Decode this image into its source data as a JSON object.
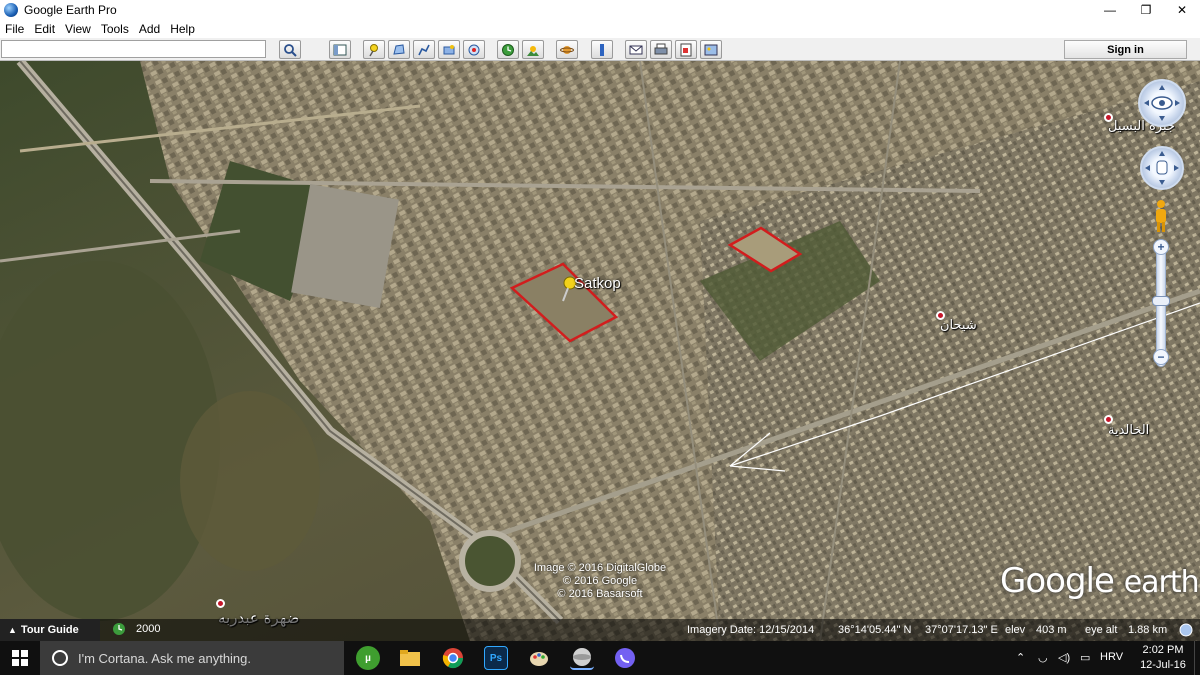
{
  "window": {
    "title": "Google Earth Pro",
    "minimize": "—",
    "maximize": "❐",
    "close": "✕"
  },
  "menu": [
    "File",
    "Edit",
    "View",
    "Tools",
    "Add",
    "Help"
  ],
  "toolbar": {
    "search_value": "",
    "sign_in": "Sign in"
  },
  "map": {
    "placemark_label": "Satkop",
    "places": [
      {
        "name": "ضهرة عبدربه"
      },
      {
        "name": "شيحان"
      },
      {
        "name": "الخالدية"
      },
      {
        "name": "جبرة البسيل"
      }
    ],
    "credits": [
      "Image © 2016 DigitalGlobe",
      "© 2016 Google",
      "© 2016 Basarsoft"
    ],
    "logo": {
      "word1": "Google",
      "word2": "earth"
    }
  },
  "nav": {
    "zoom_in": "+",
    "zoom_out": "−"
  },
  "status": {
    "tour_guide": "Tour Guide",
    "historical_year": "2000",
    "imagery_date": "Imagery Date: 12/15/2014",
    "lat": "36°14'05.44\" N",
    "lon": "37°07'17.13\" E",
    "elev_label": "elev",
    "elev_value": "403 m",
    "eye_alt_label": "eye alt",
    "eye_alt_value": "1.88 km"
  },
  "taskbar": {
    "cortana_placeholder": "I'm Cortana. Ask me anything.",
    "apps": [
      "utorrent",
      "file-explorer",
      "chrome",
      "photoshop",
      "paint",
      "google-earth",
      "viber"
    ],
    "language": "HRV",
    "time": "2:02 PM",
    "date": "12-Jul-16"
  }
}
